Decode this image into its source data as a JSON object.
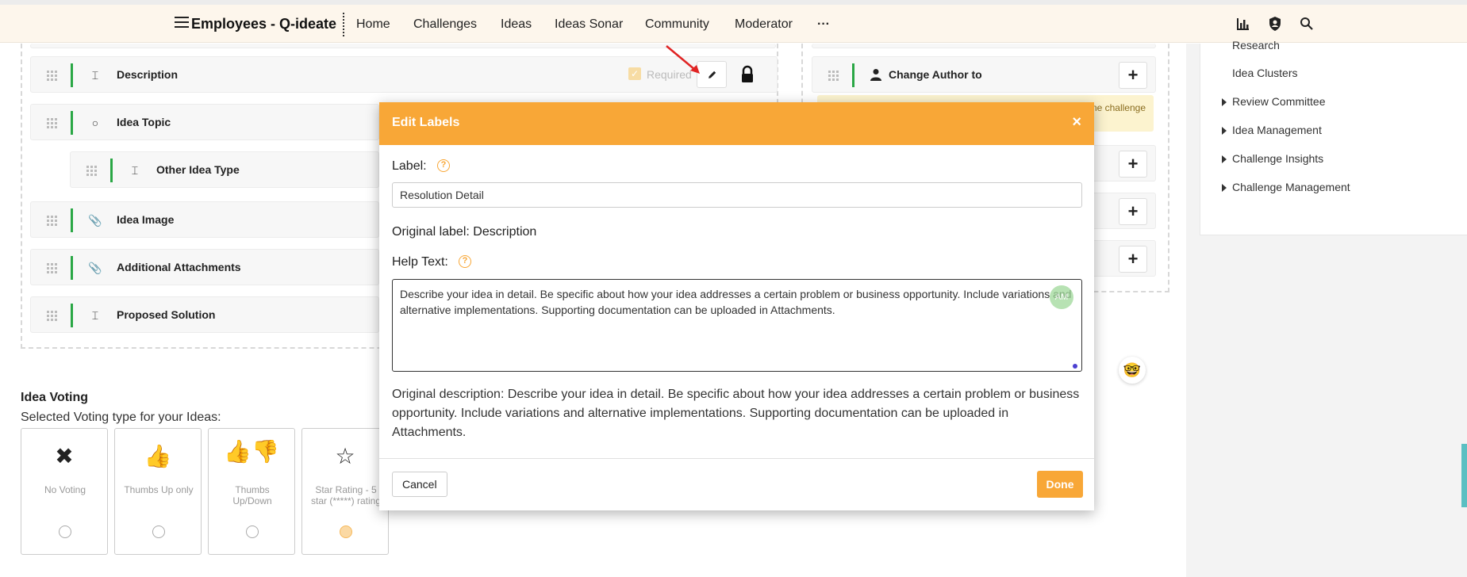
{
  "nav": {
    "brand": "Employees - Q-ideate",
    "items": [
      "Home",
      "Challenges",
      "Ideas",
      "Ideas Sonar",
      "Community",
      "Moderator"
    ],
    "more": "···"
  },
  "right_panel": {
    "items": [
      {
        "label": "Research",
        "caret": false
      },
      {
        "label": "Idea Clusters",
        "caret": false
      },
      {
        "label": "Review Committee",
        "caret": true
      },
      {
        "label": "Idea Management",
        "caret": true
      },
      {
        "label": "Challenge Insights",
        "caret": true
      },
      {
        "label": "Challenge Management",
        "caret": true
      }
    ]
  },
  "fields": [
    {
      "label": "Description",
      "icon": "text-field-icon"
    },
    {
      "label": "Idea Topic",
      "icon": "radio-icon"
    },
    {
      "label": "Other Idea Type",
      "icon": "text-field-icon"
    },
    {
      "label": "Idea Image",
      "icon": "paperclip-icon"
    },
    {
      "label": "Additional Attachments",
      "icon": "paperclip-icon"
    },
    {
      "label": "Proposed Solution",
      "icon": "text-field-icon"
    }
  ],
  "description_row": {
    "required_label": "Required",
    "required_checked": true
  },
  "mid_panel": {
    "change_author_label": "Change Author to",
    "warning_text": "ne challenge"
  },
  "voting": {
    "title": "Idea Voting",
    "subtitle": "Selected Voting type for your Ideas:",
    "options": [
      {
        "label": "No Voting",
        "icon": "close-icon",
        "selected": false
      },
      {
        "label": "Thumbs Up only",
        "icon": "thumbs-up-icon",
        "selected": false
      },
      {
        "label": "Thumbs Up/Down",
        "icon": "thumbs-up-down-icon",
        "selected": false
      },
      {
        "label": "Star Rating - 5 star (*****) rating",
        "icon": "star-icon",
        "selected": true
      }
    ]
  },
  "modal": {
    "title": "Edit Labels",
    "close": "×",
    "label_caption": "Label:",
    "label_value": "Resolution Detail",
    "original_label": "Original label: Description",
    "help_caption": "Help Text:",
    "help_value": "Describe your idea in detail. Be specific about how your idea addresses a certain problem or business opportunity. Include variations and alternative implementations. Supporting documentation can be uploaded in Attachments.",
    "avatar_initials": "AM",
    "original_description": "Original description: Describe your idea in detail. Be specific about how your idea addresses a certain problem or business opportunity. Include variations and alternative implementations. Supporting documentation can be uploaded in Attachments.",
    "cancel_label": "Cancel",
    "done_label": "Done"
  },
  "colors": {
    "accent": "#f8a737",
    "green": "#2aa745",
    "nav_bg": "#fdf6ec"
  }
}
